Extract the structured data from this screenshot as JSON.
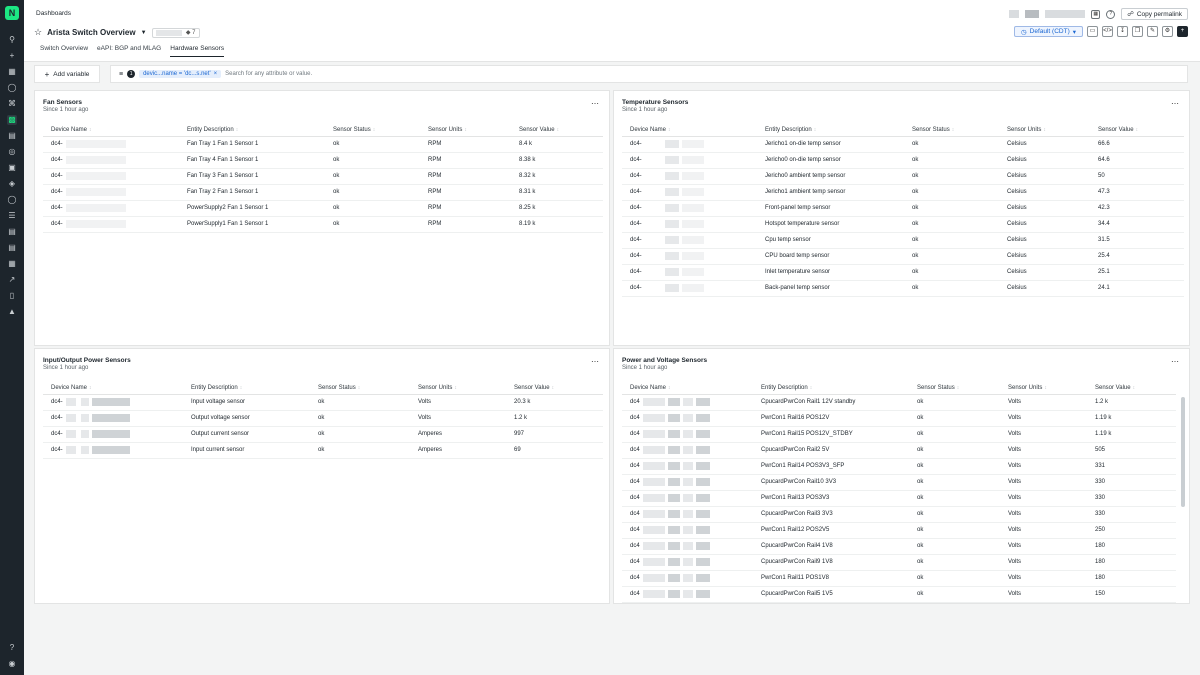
{
  "header": {
    "breadcrumb": "Dashboards",
    "title": "Arista Switch Overview",
    "tag_count": "7",
    "copy_permalink": "Copy permalink",
    "time_picker": "Default (CDT)"
  },
  "tabs": [
    {
      "label": "Switch Overview"
    },
    {
      "label": "eAPI: BGP and MLAG"
    },
    {
      "label": "Hardware Sensors"
    }
  ],
  "filter": {
    "add_variable": "Add variable",
    "count": "1",
    "chip": "devic...name = 'dc...s.net'",
    "placeholder": "Search for any attribute or value."
  },
  "columns": {
    "device": "Device Name",
    "entity": "Entity Description",
    "status": "Sensor Status",
    "units": "Sensor Units",
    "value": "Sensor Value"
  },
  "fan": {
    "title": "Fan Sensors",
    "since": "Since 1 hour ago",
    "rows": [
      {
        "device": "dc4-",
        "entity": "Fan Tray 1 Fan 1 Sensor 1",
        "status": "ok",
        "units": "RPM",
        "value": "8.4 k"
      },
      {
        "device": "dc4-",
        "entity": "Fan Tray 4 Fan 1 Sensor 1",
        "status": "ok",
        "units": "RPM",
        "value": "8.38 k"
      },
      {
        "device": "dc4-",
        "entity": "Fan Tray 3 Fan 1 Sensor 1",
        "status": "ok",
        "units": "RPM",
        "value": "8.32 k"
      },
      {
        "device": "dc4-",
        "entity": "Fan Tray 2 Fan 1 Sensor 1",
        "status": "ok",
        "units": "RPM",
        "value": "8.31 k"
      },
      {
        "device": "dc4-",
        "entity": "PowerSupply2 Fan 1 Sensor 1",
        "status": "ok",
        "units": "RPM",
        "value": "8.25 k"
      },
      {
        "device": "dc4-",
        "entity": "PowerSupply1 Fan 1 Sensor 1",
        "status": "ok",
        "units": "RPM",
        "value": "8.19 k"
      }
    ]
  },
  "temp": {
    "title": "Temperature Sensors",
    "since": "Since 1 hour ago",
    "rows": [
      {
        "device": "dc4-",
        "entity": "Jericho1 on-die temp sensor",
        "status": "ok",
        "units": "Celsius",
        "value": "66.6"
      },
      {
        "device": "dc4-",
        "entity": "Jericho0 on-die temp sensor",
        "status": "ok",
        "units": "Celsius",
        "value": "64.6"
      },
      {
        "device": "dc4-",
        "entity": "Jericho0 ambient temp sensor",
        "status": "ok",
        "units": "Celsius",
        "value": "50"
      },
      {
        "device": "dc4-",
        "entity": "Jericho1 ambient temp sensor",
        "status": "ok",
        "units": "Celsius",
        "value": "47.3"
      },
      {
        "device": "dc4-",
        "entity": "Front-panel temp sensor",
        "status": "ok",
        "units": "Celsius",
        "value": "42.3"
      },
      {
        "device": "dc4-",
        "entity": "Hotspot temperature sensor",
        "status": "ok",
        "units": "Celsius",
        "value": "34.4"
      },
      {
        "device": "dc4-",
        "entity": "Cpu temp sensor",
        "status": "ok",
        "units": "Celsius",
        "value": "31.5"
      },
      {
        "device": "dc4-",
        "entity": "CPU board temp sensor",
        "status": "ok",
        "units": "Celsius",
        "value": "25.4"
      },
      {
        "device": "dc4-",
        "entity": "Inlet temperature sensor",
        "status": "ok",
        "units": "Celsius",
        "value": "25.1"
      },
      {
        "device": "dc4-",
        "entity": "Back-panel temp sensor",
        "status": "ok",
        "units": "Celsius",
        "value": "24.1"
      }
    ]
  },
  "io": {
    "title": "Input/Output Power Sensors",
    "since": "Since 1 hour ago",
    "rows": [
      {
        "device": "dc4-",
        "entity": "Input voltage sensor",
        "status": "ok",
        "units": "Volts",
        "value": "20.3 k"
      },
      {
        "device": "dc4-",
        "entity": "Output voltage sensor",
        "status": "ok",
        "units": "Volts",
        "value": "1.2 k"
      },
      {
        "device": "dc4-",
        "entity": "Output current sensor",
        "status": "ok",
        "units": "Amperes",
        "value": "997"
      },
      {
        "device": "dc4-",
        "entity": "Input current sensor",
        "status": "ok",
        "units": "Amperes",
        "value": "69"
      }
    ]
  },
  "pv": {
    "title": "Power and Voltage Sensors",
    "since": "Since 1 hour ago",
    "rows": [
      {
        "device": "dc4",
        "entity": "CpucardPwrCon Rail1 12V standby",
        "status": "ok",
        "units": "Volts",
        "value": "1.2 k"
      },
      {
        "device": "dc4",
        "entity": "PwrCon1 Rail16 POS12V",
        "status": "ok",
        "units": "Volts",
        "value": "1.19 k"
      },
      {
        "device": "dc4",
        "entity": "PwrCon1 Rail15 POS12V_STDBY",
        "status": "ok",
        "units": "Volts",
        "value": "1.19 k"
      },
      {
        "device": "dc4",
        "entity": "CpucardPwrCon Rail2 5V",
        "status": "ok",
        "units": "Volts",
        "value": "505"
      },
      {
        "device": "dc4",
        "entity": "PwrCon1 Rail14 POS3V3_SFP",
        "status": "ok",
        "units": "Volts",
        "value": "331"
      },
      {
        "device": "dc4",
        "entity": "CpucardPwrCon Rail10 3V3",
        "status": "ok",
        "units": "Volts",
        "value": "330"
      },
      {
        "device": "dc4",
        "entity": "PwrCon1 Rail13 POS3V3",
        "status": "ok",
        "units": "Volts",
        "value": "330"
      },
      {
        "device": "dc4",
        "entity": "CpucardPwrCon Rail3 3V3",
        "status": "ok",
        "units": "Volts",
        "value": "330"
      },
      {
        "device": "dc4",
        "entity": "PwrCon1 Rail12 POS2V5",
        "status": "ok",
        "units": "Volts",
        "value": "250"
      },
      {
        "device": "dc4",
        "entity": "CpucardPwrCon Rail4 1V8",
        "status": "ok",
        "units": "Volts",
        "value": "180"
      },
      {
        "device": "dc4",
        "entity": "CpucardPwrCon Rail9 1V8",
        "status": "ok",
        "units": "Volts",
        "value": "180"
      },
      {
        "device": "dc4",
        "entity": "PwrCon1 Rail11 POS1V8",
        "status": "ok",
        "units": "Volts",
        "value": "180"
      },
      {
        "device": "dc4",
        "entity": "CpucardPwrCon Rail5 1V5",
        "status": "ok",
        "units": "Volts",
        "value": "150"
      }
    ]
  },
  "icons": {
    "logo": "new-relic-logo",
    "star": "star-icon",
    "filter": "filter-icon"
  }
}
